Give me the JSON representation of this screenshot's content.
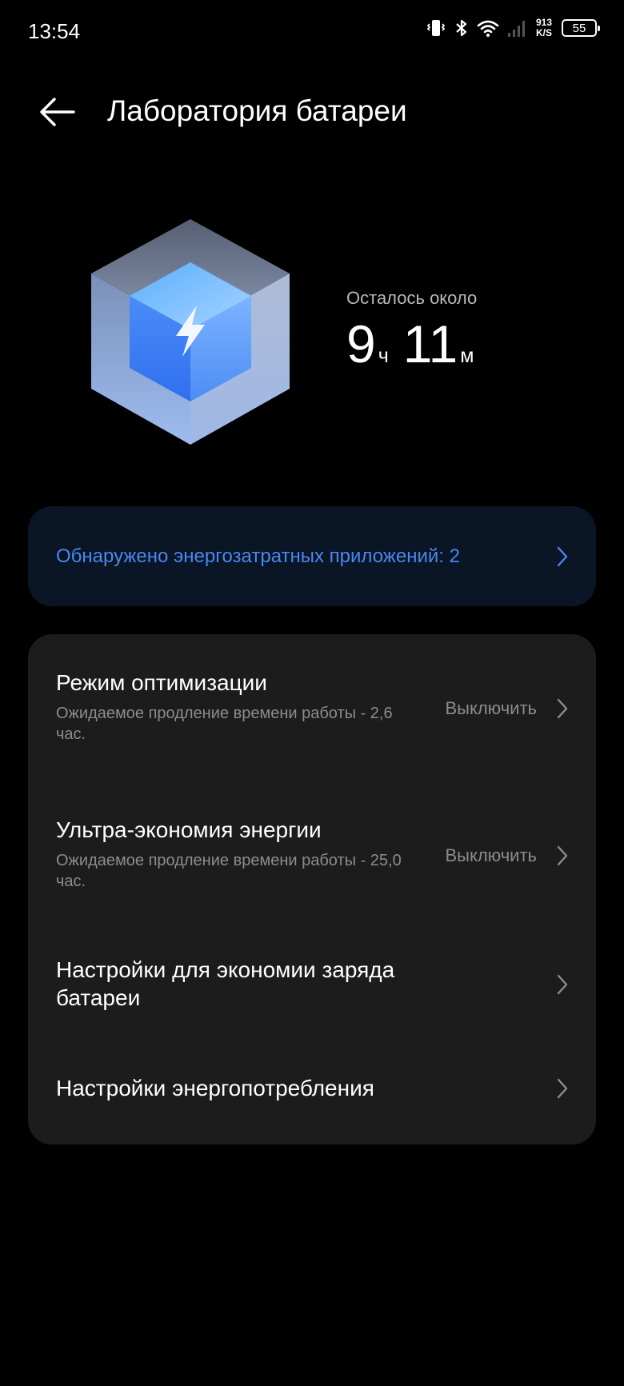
{
  "status_bar": {
    "time": "13:54",
    "net_speed_value": "913",
    "net_speed_unit": "K/S",
    "battery_level": "55"
  },
  "header": {
    "title": "Лаборатория батареи"
  },
  "battery_estimate": {
    "label": "Осталось около",
    "hours": "9",
    "hours_unit": "ч",
    "minutes": "11",
    "minutes_unit": "м"
  },
  "alert": {
    "text": "Обнаружено энергозатратных приложений: 2"
  },
  "settings": [
    {
      "title": "Режим оптимизации",
      "subtitle": "Ожидаемое продление времени работы - 2,6 час.",
      "value": "Выключить"
    },
    {
      "title": "Ультра-экономия энергии",
      "subtitle": "Ожидаемое продление времени работы - 25,0 час.",
      "value": "Выключить"
    },
    {
      "title": "Настройки для экономии заряда батареи"
    },
    {
      "title": "Настройки энергопотребления"
    }
  ],
  "colors": {
    "background": "#000000",
    "card": "#1c1c1c",
    "alert_card": "#0a1526",
    "accent": "#4a87ee",
    "secondary_text": "#8c8c8c"
  }
}
